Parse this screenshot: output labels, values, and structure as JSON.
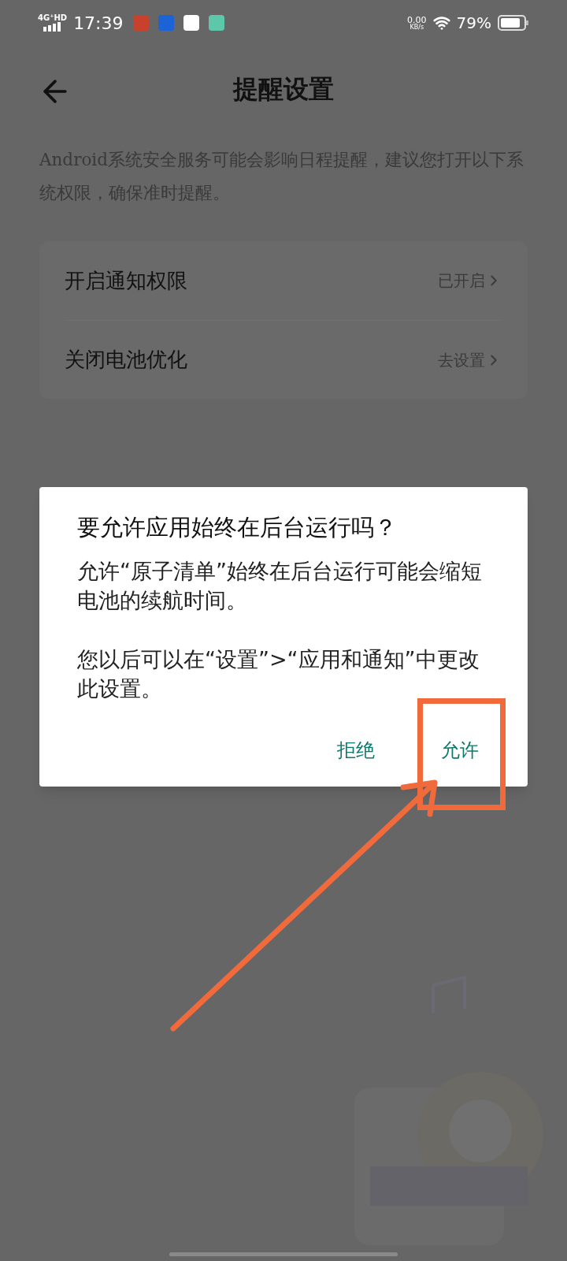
{
  "status_bar": {
    "network": "4G⁺HD",
    "time": "17:39",
    "speed": "0.00",
    "speed_unit": "KB/s",
    "battery": "79%"
  },
  "header": {
    "title": "提醒设置"
  },
  "description": "Android系统安全服务可能会影响日程提醒，建议您打开以下系统权限，确保准时提醒。",
  "settings": [
    {
      "label": "开启通知权限",
      "value": "已开启"
    },
    {
      "label": "关闭电池优化",
      "value": "去设置"
    }
  ],
  "dialog": {
    "title": "要允许应用始终在后台运行吗？",
    "paragraphs": [
      "允许“原子清单”始终在后台运行可能会缩短电池的续航时间。",
      "您以后可以在“设置”>“应用和通知”中更改此设置。"
    ],
    "buttons": [
      "拒绝",
      "允许"
    ]
  }
}
